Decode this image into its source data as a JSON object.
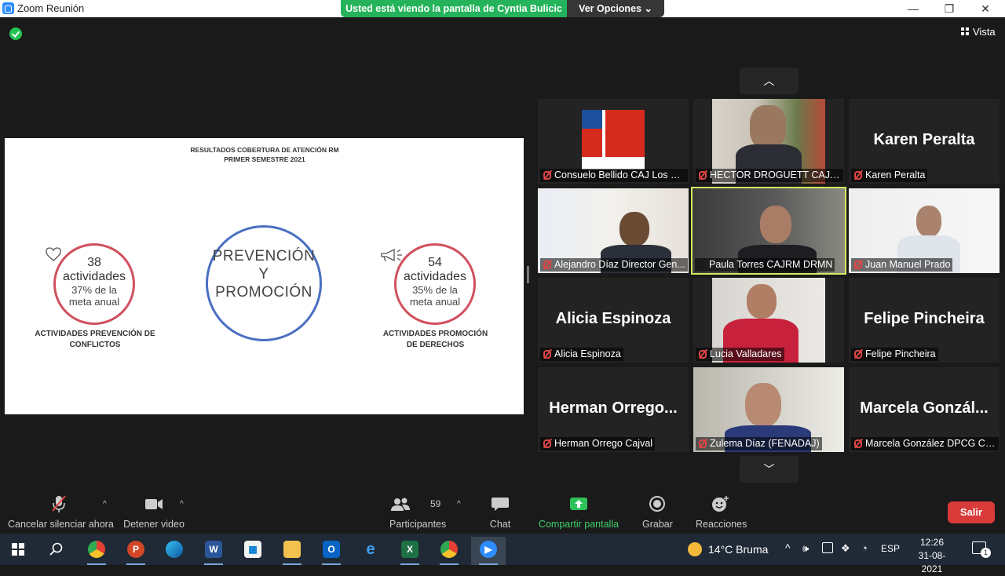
{
  "window": {
    "title": "Zoom Reunión",
    "minimize": "—",
    "maximize": "❐",
    "close": "✕"
  },
  "share_banner": {
    "viewing_text": "Usted está viendo la pantalla de Cyntia Bulicic",
    "options_label": "Ver Opciones ⌄"
  },
  "view_button": "Vista",
  "slide": {
    "title_line1": "RESULTADOS COBERTURA DE ATENCIÓN RM",
    "title_line2": "PRIMER SEMESTRE 2021",
    "left": {
      "number": "38",
      "unit": "actividades",
      "pct_line1": "37% de la",
      "pct_line2": "meta anual",
      "caption_line1": "ACTIVIDADES PREVENCIÓN DE",
      "caption_line2": "CONFLICTOS"
    },
    "center": {
      "line1": "PREVENCIÓN",
      "line2": "Y",
      "line3": "PROMOCIÓN"
    },
    "right": {
      "number": "54",
      "unit": "actividades",
      "pct_line1": "35% de la",
      "pct_line2": "meta anual",
      "caption_line1": "ACTIVIDADES PROMOCIÓN",
      "caption_line2": "DE DERECHOS"
    }
  },
  "participants": [
    {
      "label": "Consuelo Bellido CAJ Los La...",
      "big_name": ""
    },
    {
      "label": "HECTOR DROGUETT CAJME...",
      "big_name": ""
    },
    {
      "label": "Karen Peralta",
      "big_name": "Karen Peralta"
    },
    {
      "label": "Alejandro Díaz Director Gen...",
      "big_name": ""
    },
    {
      "label": "Paula Torres CAJRM DRMN",
      "big_name": ""
    },
    {
      "label": "Juan Manuel Prado",
      "big_name": ""
    },
    {
      "label": "Alicia Espinoza",
      "big_name": "Alicia Espinoza"
    },
    {
      "label": "Lucia Valladares",
      "big_name": ""
    },
    {
      "label": "Felipe Pincheira",
      "big_name": "Felipe Pincheira"
    },
    {
      "label": "Herman Orrego Cajval",
      "big_name": "Herman  Orrego..."
    },
    {
      "label": "Zulema Díaz (FENADAJ)",
      "big_name": ""
    },
    {
      "label": "Marcela González DPCG CA...",
      "big_name": "Marcela  Gonzál..."
    }
  ],
  "toolbar": {
    "mute": "Cancelar silenciar ahora",
    "video": "Detener video",
    "participants": "Participantes",
    "participants_count": "59",
    "chat": "Chat",
    "share": "Compartir pantalla",
    "record": "Grabar",
    "reactions": "Reacciones",
    "leave": "Salir"
  },
  "taskbar": {
    "weather": "14°C  Bruma",
    "lang": "ESP",
    "time": "12:26",
    "date": "31-08-2021",
    "notifications": "1"
  },
  "colors": {
    "share_green": "#24b35a",
    "leave_red": "#d93a3a",
    "speaker_outline": "#d6e85c",
    "ring_red": "#d0505f",
    "ring_blue": "#4a6fc2"
  }
}
